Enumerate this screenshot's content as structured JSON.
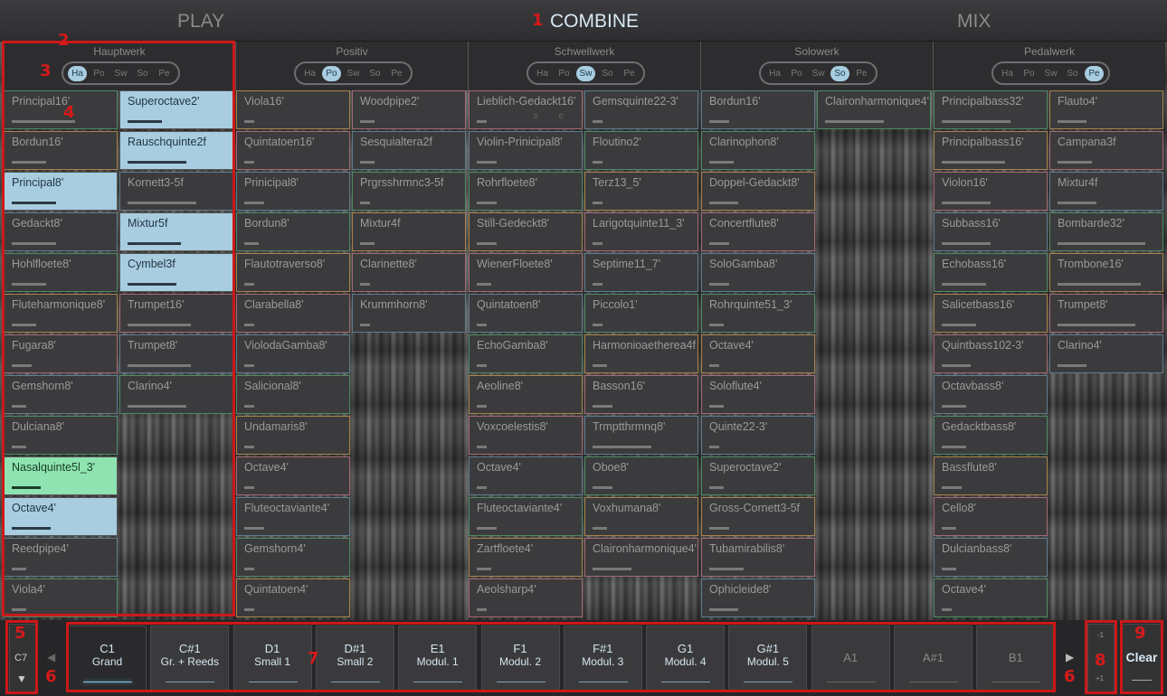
{
  "tabs": {
    "play": "PLAY",
    "combine": "COMBINE",
    "mix": "MIX"
  },
  "annotations": [
    "1",
    "2",
    "3",
    "4",
    "5",
    "6",
    "7",
    "6",
    "8",
    "9"
  ],
  "divisions": [
    {
      "name": "Hauptwerk",
      "active": "Ha",
      "left": [
        {
          "label": "Principal16'",
          "state": "off",
          "level": 0.65
        },
        {
          "label": "Bordun16'",
          "state": "off",
          "level": 0.35
        },
        {
          "label": "Principal8'",
          "state": "on",
          "level": 0.45
        },
        {
          "label": "Gedackt8'",
          "state": "off",
          "level": 0.45
        },
        {
          "label": "Hohlfloete8'",
          "state": "off",
          "level": 0.35
        },
        {
          "label": "Fluteharmonique8'",
          "state": "off",
          "level": 0.25
        },
        {
          "label": "Fugara8'",
          "state": "off",
          "level": 0.2
        },
        {
          "label": "Gemshorn8'",
          "state": "off",
          "level": 0.15
        },
        {
          "label": "Dulciana8'",
          "state": "off",
          "level": 0.15
        },
        {
          "label": "Nasalquinte5l_3'",
          "state": "green",
          "level": 0.3
        },
        {
          "label": "Octave4'",
          "state": "on",
          "level": 0.4
        },
        {
          "label": "Reedpipe4'",
          "state": "off",
          "level": 0.15
        },
        {
          "label": "Viola4'",
          "state": "off",
          "level": 0.15
        }
      ],
      "right": [
        {
          "label": "Superoctave2'",
          "state": "on",
          "level": 0.35
        },
        {
          "label": "Rauschquinte2f",
          "state": "on",
          "level": 0.6
        },
        {
          "label": "Kornett3-5f",
          "state": "off",
          "level": 0.7
        },
        {
          "label": "Mixtur5f",
          "state": "on",
          "level": 0.55
        },
        {
          "label": "Cymbel3f",
          "state": "on",
          "level": 0.5
        },
        {
          "label": "Trumpet16'",
          "state": "off",
          "level": 0.65
        },
        {
          "label": "Trumpet8'",
          "state": "off",
          "level": 0.65
        },
        {
          "label": "Clarino4'",
          "state": "off",
          "level": 0.6
        }
      ]
    },
    {
      "name": "Positiv",
      "active": "Po",
      "left": [
        {
          "label": "Viola16'",
          "state": "off",
          "level": 0.1
        },
        {
          "label": "Quintatoen16'",
          "state": "off",
          "level": 0.1
        },
        {
          "label": "Prinicipal8'",
          "state": "off",
          "level": 0.2
        },
        {
          "label": "Bordun8'",
          "state": "off",
          "level": 0.15
        },
        {
          "label": "Flautotraverso8'",
          "state": "off",
          "level": 0.1
        },
        {
          "label": "Clarabella8'",
          "state": "off",
          "level": 0.1
        },
        {
          "label": "ViolodaGamba8'",
          "state": "off",
          "level": 0.1
        },
        {
          "label": "Salicional8'",
          "state": "off",
          "level": 0.1
        },
        {
          "label": "Undamaris8'",
          "state": "off",
          "level": 0.1
        },
        {
          "label": "Octave4'",
          "state": "off",
          "level": 0.1
        },
        {
          "label": "Fluteoctaviante4'",
          "state": "off",
          "level": 0.2
        },
        {
          "label": "Gemshorn4'",
          "state": "off",
          "level": 0.1
        },
        {
          "label": "Quintatoen4'",
          "state": "off",
          "level": 0.1
        }
      ],
      "right": [
        {
          "label": "Woodpipe2'",
          "state": "off",
          "level": 0.15
        },
        {
          "label": "Sesquialtera2f",
          "state": "off",
          "level": 0.15
        },
        {
          "label": "Prgrsshrmnc3-5f",
          "state": "off",
          "level": 0.1
        },
        {
          "label": "Mixtur4f",
          "state": "off",
          "level": 0.15
        },
        {
          "label": "Clarinette8'",
          "state": "off",
          "level": 0.1
        },
        {
          "label": "Krummhorn8'",
          "state": "off",
          "level": 0.1
        }
      ]
    },
    {
      "name": "Schwellwerk",
      "active": "Sw",
      "left": [
        {
          "label": "Lieblich-Gedackt16'",
          "state": "off",
          "level": 0.1
        },
        {
          "label": "Violin-Prinicipal8'",
          "state": "off",
          "level": 0.2
        },
        {
          "label": "Rohrfloete8'",
          "state": "off",
          "level": 0.2
        },
        {
          "label": "Still-Gedeckt8'",
          "state": "off",
          "level": 0.2
        },
        {
          "label": "WienerFloete8'",
          "state": "off",
          "level": 0.15
        },
        {
          "label": "Quintatoen8'",
          "state": "off",
          "level": 0.1
        },
        {
          "label": "EchoGamba8'",
          "state": "off",
          "level": 0.1
        },
        {
          "label": "Aeoline8'",
          "state": "off",
          "level": 0.1
        },
        {
          "label": "Voxcoelestis8'",
          "state": "off",
          "level": 0.1
        },
        {
          "label": "Octave4'",
          "state": "off",
          "level": 0.1
        },
        {
          "label": "Fluteoctaviante4'",
          "state": "off",
          "level": 0.2
        },
        {
          "label": "Zartfloete4'",
          "state": "off",
          "level": 0.15
        },
        {
          "label": "Aeolsharp4'",
          "state": "off",
          "level": 0.1
        }
      ],
      "right": [
        {
          "label": "Gemsquinte22-3'",
          "state": "off",
          "level": 0.1
        },
        {
          "label": "Floutino2'",
          "state": "off",
          "level": 0.1
        },
        {
          "label": "Terz13_5'",
          "state": "off",
          "level": 0.1
        },
        {
          "label": "Larigotquinte11_3'",
          "state": "off",
          "level": 0.1
        },
        {
          "label": "Septime11_7'",
          "state": "off",
          "level": 0.1
        },
        {
          "label": "Piccolo1'",
          "state": "off",
          "level": 0.1
        },
        {
          "label": "Harmonioaetherea4f",
          "state": "off",
          "level": 0.15
        },
        {
          "label": "Basson16'",
          "state": "off",
          "level": 0.2
        },
        {
          "label": "Trmptthrmnq8'",
          "state": "off",
          "level": 0.6
        },
        {
          "label": "Oboe8'",
          "state": "off",
          "level": 0.2
        },
        {
          "label": "Voxhumana8'",
          "state": "off",
          "level": 0.15
        },
        {
          "label": "Claironharmonique4'",
          "state": "off",
          "level": 0.4
        }
      ]
    },
    {
      "name": "Solowerk",
      "active": "So",
      "left": [
        {
          "label": "Bordun16'",
          "state": "off",
          "level": 0.2
        },
        {
          "label": "Clarinophon8'",
          "state": "off",
          "level": 0.25
        },
        {
          "label": "Doppel-Gedackt8'",
          "state": "off",
          "level": 0.3
        },
        {
          "label": "Concertflute8'",
          "state": "off",
          "level": 0.2
        },
        {
          "label": "SoloGamba8'",
          "state": "off",
          "level": 0.2
        },
        {
          "label": "Rohrquinte51_3'",
          "state": "off",
          "level": 0.15
        },
        {
          "label": "Octave4'",
          "state": "off",
          "level": 0.1
        },
        {
          "label": "Soloflute4'",
          "state": "off",
          "level": 0.15
        },
        {
          "label": "Quinte22-3'",
          "state": "off",
          "level": 0.1
        },
        {
          "label": "Superoctave2'",
          "state": "off",
          "level": 0.15
        },
        {
          "label": "Gross-Cornett3-5f",
          "state": "off",
          "level": 0.2
        },
        {
          "label": "Tubamirabilis8'",
          "state": "off",
          "level": 0.35
        },
        {
          "label": "Ophicleide8'",
          "state": "off",
          "level": 0.3
        }
      ],
      "right": [
        {
          "label": "Claironharmonique4'",
          "state": "off",
          "level": 0.6
        }
      ]
    },
    {
      "name": "Pedalwerk",
      "active": "Pe",
      "left": [
        {
          "label": "Principalbass32'",
          "state": "off",
          "level": 0.7
        },
        {
          "label": "Principalbass16'",
          "state": "off",
          "level": 0.65
        },
        {
          "label": "Violon16'",
          "state": "off",
          "level": 0.5
        },
        {
          "label": "Subbass16'",
          "state": "off",
          "level": 0.5
        },
        {
          "label": "Echobass16'",
          "state": "off",
          "level": 0.45
        },
        {
          "label": "Salicetbass16'",
          "state": "off",
          "level": 0.35
        },
        {
          "label": "Quintbass102-3'",
          "state": "off",
          "level": 0.3
        },
        {
          "label": "Octavbass8'",
          "state": "off",
          "level": 0.25
        },
        {
          "label": "Gedacktbass8'",
          "state": "off",
          "level": 0.25
        },
        {
          "label": "Bassflute8'",
          "state": "off",
          "level": 0.2
        },
        {
          "label": "Cello8'",
          "state": "off",
          "level": 0.15
        },
        {
          "label": "Dulcianbass8'",
          "state": "off",
          "level": 0.15
        },
        {
          "label": "Octave4'",
          "state": "off",
          "level": 0.1
        }
      ],
      "right": [
        {
          "label": "Flauto4'",
          "state": "off",
          "level": 0.3
        },
        {
          "label": "Campana3f",
          "state": "off",
          "level": 0.35
        },
        {
          "label": "Mixtur4f",
          "state": "off",
          "level": 0.4
        },
        {
          "label": "Bombarde32'",
          "state": "off",
          "level": 0.9
        },
        {
          "label": "Trombone16'",
          "state": "off",
          "level": 0.85
        },
        {
          "label": "Trumpet8'",
          "state": "off",
          "level": 0.8
        },
        {
          "label": "Clarino4'",
          "state": "off",
          "level": 0.3
        }
      ]
    }
  ],
  "channels": [
    "Ha",
    "Po",
    "Sw",
    "So",
    "Pe"
  ],
  "sub_labels": "s e",
  "octave": {
    "label": "C7",
    "down": "▼"
  },
  "arrows": {
    "left": "◀",
    "right": "▶"
  },
  "notes": [
    {
      "note": "C1",
      "name": "Grand",
      "selected": true
    },
    {
      "note": "C#1",
      "name": "Gr. + Reeds"
    },
    {
      "note": "D1",
      "name": "Small 1"
    },
    {
      "note": "D#1",
      "name": "Small 2"
    },
    {
      "note": "E1",
      "name": "Modul. 1"
    },
    {
      "note": "F1",
      "name": "Modul. 2"
    },
    {
      "note": "F#1",
      "name": "Modul. 3"
    },
    {
      "note": "G1",
      "name": "Modul. 4"
    },
    {
      "note": "G#1",
      "name": "Modul. 5"
    },
    {
      "note": "A1",
      "name": "",
      "empty": true
    },
    {
      "note": "A#1",
      "name": "",
      "empty": true
    },
    {
      "note": "B1",
      "name": "",
      "empty": true
    }
  ],
  "transpose": {
    "minus": "-1",
    "plus": "+1"
  },
  "clear": "Clear",
  "colors": {
    "active": "#a8cde0",
    "green": "#8ee3b0",
    "annotation": "#d61a1a",
    "border_green": "#4d8a63",
    "border_orange": "#a8834a",
    "border_pink": "#a46a72",
    "border_blue": "#5d7d8d"
  }
}
